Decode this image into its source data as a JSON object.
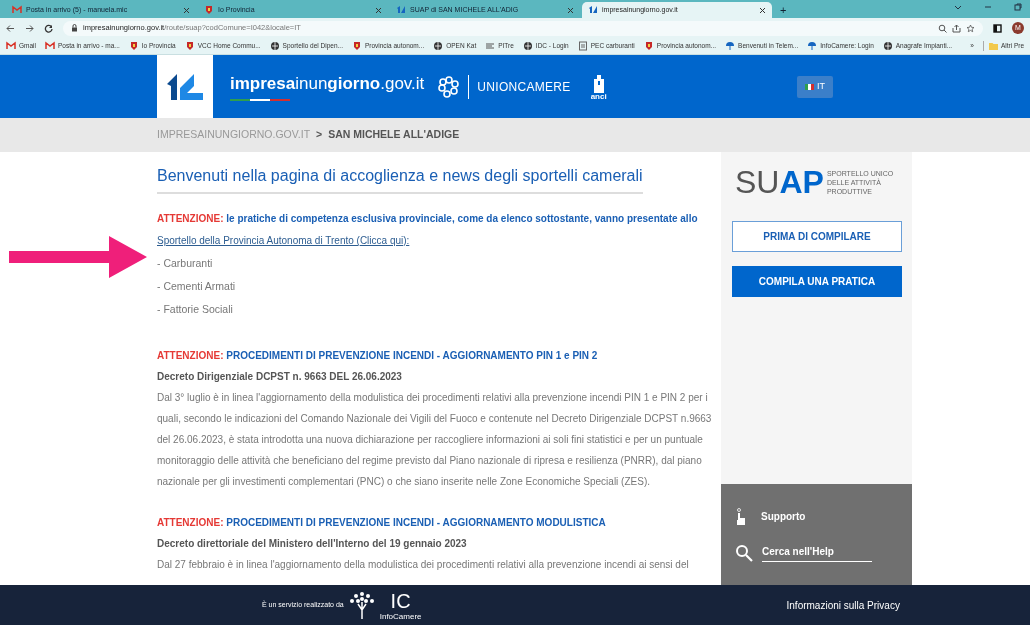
{
  "browser": {
    "tabs": [
      {
        "title": "Posta in arrivo (5) - manuela.mic",
        "selected": false
      },
      {
        "title": "Io Provincia",
        "selected": false
      },
      {
        "title": "SUAP di SAN MICHELE ALL'ADIG",
        "selected": false
      },
      {
        "title": "impresainungiorno.gov.it",
        "selected": true
      }
    ],
    "new_tab": "+",
    "url_host": "impresainungiorno.gov.it",
    "url_path": "/route/suap?codComune=I042&locale=IT",
    "profile": "M",
    "bookmarks": [
      "Gmail",
      "Posta in arrivo - ma...",
      "Io Provincia",
      "VCC Home Commu...",
      "Sportello del Dipen...",
      "Provincia autonom...",
      "OPEN Kat",
      "PITre",
      "IDC - Login",
      "PEC carburanti",
      "Provincia autonom...",
      "Benvenuti in Telem...",
      "InfoCamere: Login",
      "Anagrafe Impianti..."
    ],
    "overflow": "»",
    "other_bookmarks": "Altri Pre"
  },
  "header": {
    "site_name": "**impresa**inun**giorno**.gov.it",
    "partner": "UNIONCAMERE",
    "anci": "anci",
    "language": "IT"
  },
  "breadcrumb": [
    "IMPRESAINUNGIORNO.GOV.IT",
    "SAN MICHELE ALL'ADIGE"
  ],
  "breadcrumb_separator": ">",
  "main": {
    "heading": "Benvenuti nella pagina di accoglienza e news degli sportelli camerali",
    "notice": {
      "label": "ATTENZIONE:",
      "text": "le pratiche di competenza esclusiva provinciale, come da elenco sottostante, vanno presentate allo",
      "link": "Sportello della Provincia Autonoma di Trento (Clicca qui):"
    },
    "list": [
      "- Carburanti",
      "- Cementi Armati",
      "- Fattorie Sociali"
    ],
    "news": [
      {
        "label": "ATTENZIONE:",
        "title": "PROCEDIMENTI DI PREVENZIONE INCENDI - AGGIORNAMENTO PIN 1 e PIN 2",
        "subtitle": "Decreto Dirigenziale DCPST n. 9663 DEL 26.06.2023",
        "body": "Dal 3° luglio è in linea l'aggiornamento della modulistica dei procedimenti relativi alla prevenzione incendi PIN 1 e PIN 2 per i quali, secondo le indicazioni del Comando Nazionale dei Vigili del Fuoco e contenute nel Decreto Dirigenziale DCPST n.9663 del 26.06.2023, è stata introdotta una nuova dichiarazione per raccogliere informazioni ai soli fini statistici e per un puntuale monitoraggio delle attività che beneficiano del regime previsto dal Piano nazionale di ripresa e resilienza (PNRR), dal piano nazionale per gli investimenti complementari (PNC) o che siano inserite nelle Zone Economiche Speciali (ZES)."
      },
      {
        "label": "ATTENZIONE:",
        "title": "PROCEDIMENTI DI PREVENZIONE INCENDI - AGGIORNAMENTO MODULISTICA",
        "subtitle": "Decreto direttoriale del Ministero dell'Interno del 19 gennaio 2023",
        "body": "Dal 27 febbraio è in linea l'aggiornamento della modulistica dei procedimenti relativi alla prevenzione incendi ai sensi del"
      }
    ]
  },
  "sidebar": {
    "logo_left": "SU",
    "logo_right": "AP",
    "tagline": [
      "SPORTELLO UNICO",
      "DELLE ATTIVITÀ",
      "PRODUTTIVE"
    ],
    "buttons": [
      {
        "label": "PRIMA DI COMPILARE",
        "kind": "outline"
      },
      {
        "label": "COMPILA UNA PRATICA",
        "kind": "filled"
      }
    ],
    "support": "Supporto",
    "help_search": "Cerca nell'Help"
  },
  "footer": {
    "credit": "È un servizio realizzato da",
    "ic": "IC",
    "ic_sub": "InfoCamere",
    "privacy": "Informazioni sulla Privacy"
  }
}
